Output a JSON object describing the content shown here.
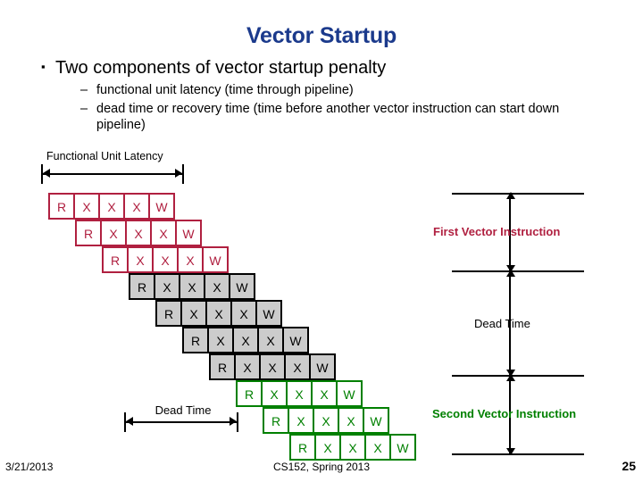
{
  "slide": {
    "title": "Vector Startup",
    "title_color": "#1b3a8c"
  },
  "bullets": {
    "level1": {
      "marker": "▪",
      "text": "Two components of vector startup penalty"
    },
    "level2": [
      {
        "marker": "–",
        "text": "functional unit latency (time through pipeline)"
      },
      {
        "marker": "–",
        "text": "dead time or recovery time (time before another vector instruction can start down pipeline)"
      }
    ]
  },
  "diagram": {
    "functional_unit_latency_label": "Functional Unit Latency",
    "dead_time_label": "Dead Time",
    "stage_names": [
      "R",
      "X",
      "X",
      "X",
      "W"
    ],
    "colors": {
      "first_instruction": "#b02040",
      "dead_time": "#000000",
      "second_instruction": "#008000",
      "gray_fill": "#cccccc"
    },
    "groups": [
      {
        "name": "first-vector-instruction",
        "color": "#b02040",
        "rows": [
          {
            "offset": 0,
            "stages": [
              "R",
              "X",
              "X",
              "X",
              "W"
            ]
          },
          {
            "offset": 1,
            "stages": [
              "R",
              "X",
              "X",
              "X",
              "W"
            ]
          },
          {
            "offset": 2,
            "stages": [
              "R",
              "X",
              "X",
              "X",
              "W"
            ]
          }
        ]
      },
      {
        "name": "dead-time",
        "color": "#000000",
        "rows": [
          {
            "offset": 3,
            "stages": [
              "R",
              "X",
              "X",
              "X",
              "W"
            ]
          },
          {
            "offset": 4,
            "stages": [
              "R",
              "X",
              "X",
              "X",
              "W"
            ]
          },
          {
            "offset": 5,
            "stages": [
              "R",
              "X",
              "X",
              "X",
              "W"
            ]
          },
          {
            "offset": 6,
            "stages": [
              "R",
              "X",
              "X",
              "X",
              "W"
            ]
          }
        ]
      },
      {
        "name": "second-vector-instruction",
        "color": "#008000",
        "rows": [
          {
            "offset": 7,
            "stages": [
              "R",
              "X",
              "X",
              "X",
              "W"
            ]
          },
          {
            "offset": 8,
            "stages": [
              "R",
              "X",
              "X",
              "X",
              "W"
            ]
          },
          {
            "offset": 9,
            "stages": [
              "R",
              "X",
              "X",
              "X",
              "W"
            ]
          }
        ]
      }
    ],
    "annotations": [
      {
        "name": "first-vector-instruction",
        "label": "First Vector Instruction",
        "color": "#b02040"
      },
      {
        "name": "dead-time",
        "label": "Dead Time",
        "color": "#000000"
      },
      {
        "name": "second-vector-instruction",
        "label": "Second Vector Instruction",
        "color": "#008000"
      }
    ]
  },
  "footer": {
    "date": "3/21/2013",
    "course": "CS152, Spring 2013",
    "page": "25"
  }
}
